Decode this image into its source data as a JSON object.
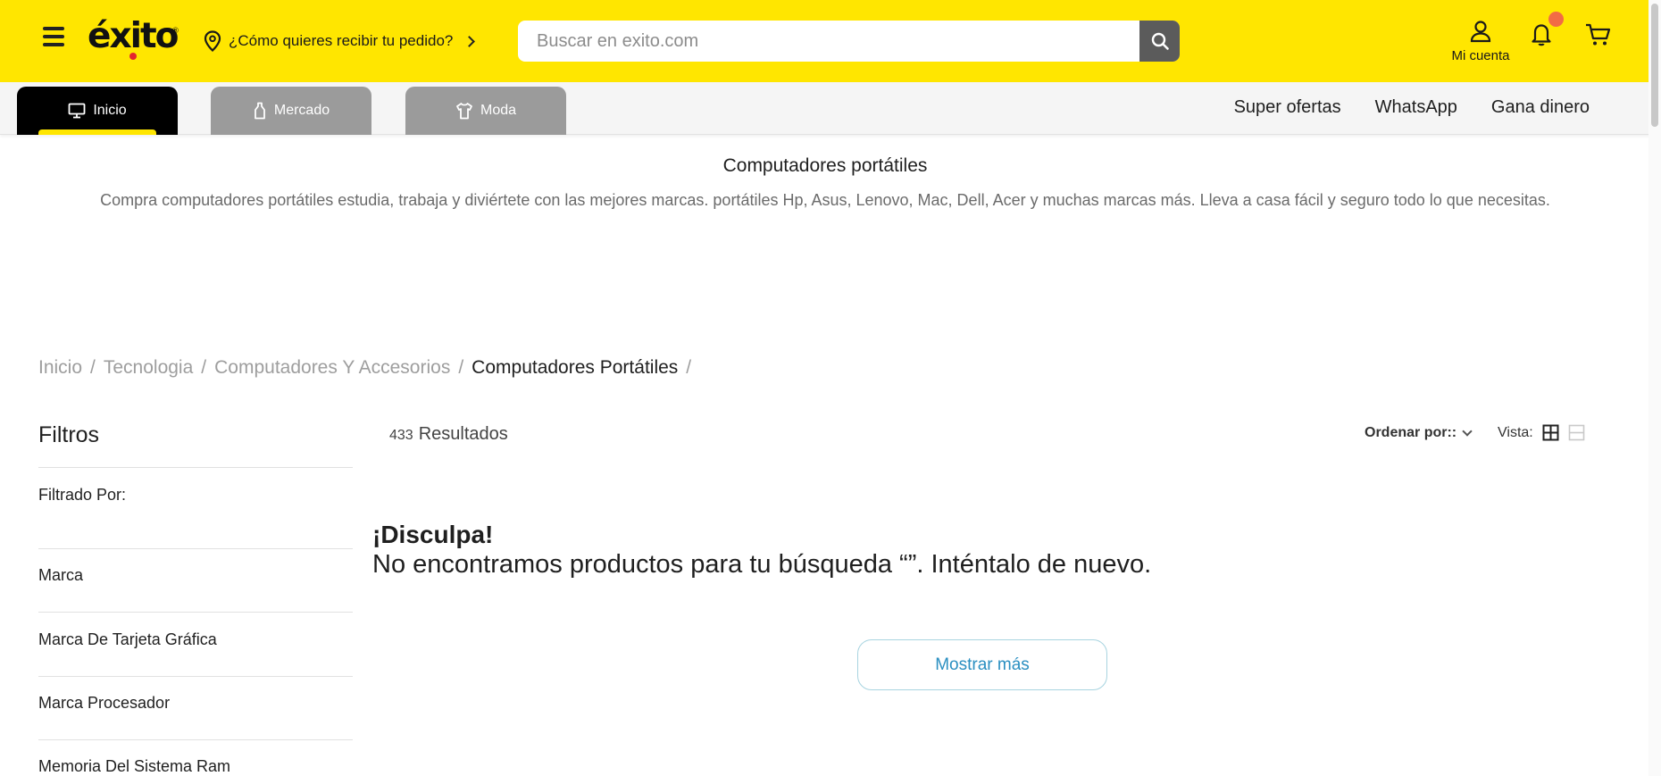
{
  "header": {
    "logo_text": "éxito",
    "delivery_prompt": "¿Cómo quieres recibir tu pedido?",
    "search_placeholder": "Buscar en exito.com",
    "account_label": "Mi cuenta",
    "brand_color": "#ffe600",
    "icons": [
      "menu-icon",
      "location-pin-icon",
      "chevron-right-icon",
      "search-icon",
      "user-icon",
      "bell-icon",
      "cart-icon"
    ]
  },
  "nav": {
    "tabs": [
      {
        "label": "Inicio",
        "icon": "monitor-icon",
        "active": true
      },
      {
        "label": "Mercado",
        "icon": "bottle-icon",
        "active": false
      },
      {
        "label": "Moda",
        "icon": "shirt-icon",
        "active": false
      }
    ],
    "links": [
      "Super ofertas",
      "WhatsApp",
      "Gana dinero"
    ]
  },
  "category": {
    "title": "Computadores portátiles",
    "description": "Compra computadores portátiles estudia, trabaja y diviértete con las mejores marcas. portátiles Hp, Asus, Lenovo, Mac, Dell, Acer y muchas marcas más. Lleva a casa fácil y seguro todo lo que necesitas."
  },
  "breadcrumb": {
    "items": [
      "Inicio",
      "Tecnologia",
      "Computadores Y Accesorios",
      "Computadores Portátiles"
    ],
    "separator": "/"
  },
  "filters": {
    "title": "Filtros",
    "filtered_by": "Filtrado Por:",
    "facets": [
      "Marca",
      "Marca De Tarjeta Gráfica",
      "Marca Procesador",
      "Memoria Del Sistema Ram"
    ]
  },
  "results": {
    "count": "433",
    "label": "Resultados",
    "sort_label": "Ordenar por::",
    "view_label": "Vista:"
  },
  "empty_state": {
    "title": "¡Disculpa!",
    "message": "No encontramos productos para tu búsqueda  “”. Inténtalo de nuevo.",
    "button": "Mostrar más"
  }
}
